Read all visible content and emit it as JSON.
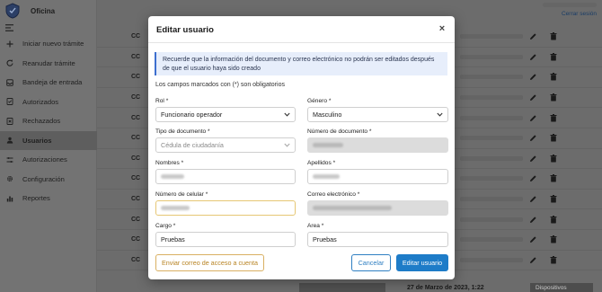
{
  "app": {
    "name": "Oficina",
    "logout": "Cerrar sesión"
  },
  "sidebar": {
    "items": [
      {
        "label": "Iniciar nuevo trámite",
        "icon": "plus-icon"
      },
      {
        "label": "Reanudar trámite",
        "icon": "refresh-icon"
      },
      {
        "label": "Bandeja de entrada",
        "icon": "inbox-icon"
      },
      {
        "label": "Autorizados",
        "icon": "check-doc-icon"
      },
      {
        "label": "Rechazados",
        "icon": "reject-doc-icon"
      },
      {
        "label": "Usuarios",
        "icon": "users-icon",
        "active": true
      },
      {
        "label": "Autorizaciones",
        "icon": "sliders-icon"
      },
      {
        "label": "Configuración",
        "icon": "gear-icon"
      },
      {
        "label": "Reportes",
        "icon": "chart-icon"
      }
    ]
  },
  "table": {
    "rows": [
      "CC",
      "CC",
      "CC",
      "CC",
      "CC",
      "CC",
      "CC",
      "CC",
      "CC",
      "CC",
      "CC",
      "CC"
    ]
  },
  "footer": {
    "date": "27 de Marzo de 2023, 1:22",
    "device": "Dispositivos"
  },
  "modal": {
    "title": "Editar usuario",
    "close": "×",
    "notice": "Recuerde que la información del documento y correo electrónico no podrán ser editados después de que el usuario haya sido creado",
    "required_note": "Los campos marcados con (*) son obligatorios",
    "fields": {
      "rol": {
        "label": "Rol *",
        "value": "Funcionario operador"
      },
      "genero": {
        "label": "Género *",
        "value": "Masculino"
      },
      "tipo_doc": {
        "label": "Tipo de documento *",
        "value": "Cédula de ciudadanía"
      },
      "num_doc": {
        "label": "Número de documento *"
      },
      "nombres": {
        "label": "Nombres *"
      },
      "apellidos": {
        "label": "Apellidos *"
      },
      "celular": {
        "label": "Número de celular *"
      },
      "correo": {
        "label": "Correo electrónico *"
      },
      "cargo": {
        "label": "Cargo *",
        "value": "Pruebas"
      },
      "area": {
        "label": "Area *",
        "value": "Pruebas"
      }
    },
    "buttons": {
      "send_access": "Enviar correo de acceso a cuenta",
      "cancel": "Cancelar",
      "submit": "Editar usuario"
    }
  },
  "colors": {
    "primary": "#1e7cc8",
    "warning": "#d9b062",
    "notice_bg": "#e7eefb"
  }
}
